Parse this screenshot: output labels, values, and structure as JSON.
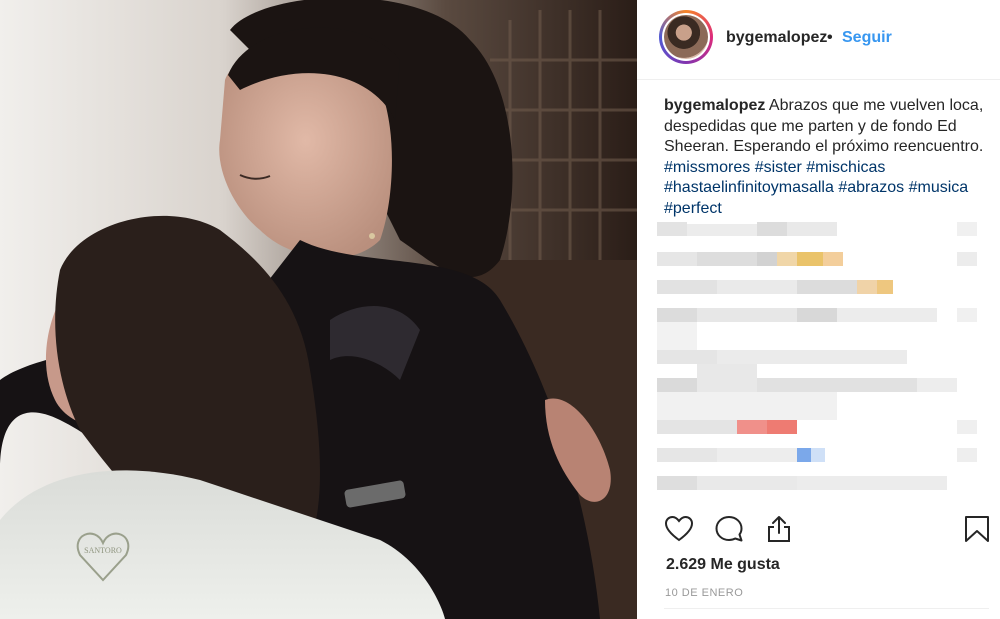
{
  "post": {
    "username": "bygemalopez",
    "separator": "•",
    "follow_label": "Seguir",
    "caption_user": "bygemalopez",
    "caption_text": " Abrazos que me vuelven loca, despedidas que me parten y de fondo Ed Sheeran. Esperando el próximo reencuentro. ",
    "hashtags": [
      "#missmores",
      "#sister",
      "#mischicas",
      "#hastaelinfinitoymasalla",
      "#abrazos",
      "#musica",
      "#perfect"
    ],
    "likes_label": "2.629 Me gusta",
    "date_label": "10 DE ENERO"
  },
  "photo": {
    "alt_subject": "two people hugging",
    "shirt_logo_text": "SANTORO"
  },
  "icons": {
    "like": "heart-icon",
    "comment": "comment-bubble-icon",
    "share": "share-icon",
    "save": "bookmark-icon"
  },
  "colors": {
    "link": "#3897f0",
    "hashtag": "#003569",
    "text": "#262626",
    "muted": "#999999"
  }
}
